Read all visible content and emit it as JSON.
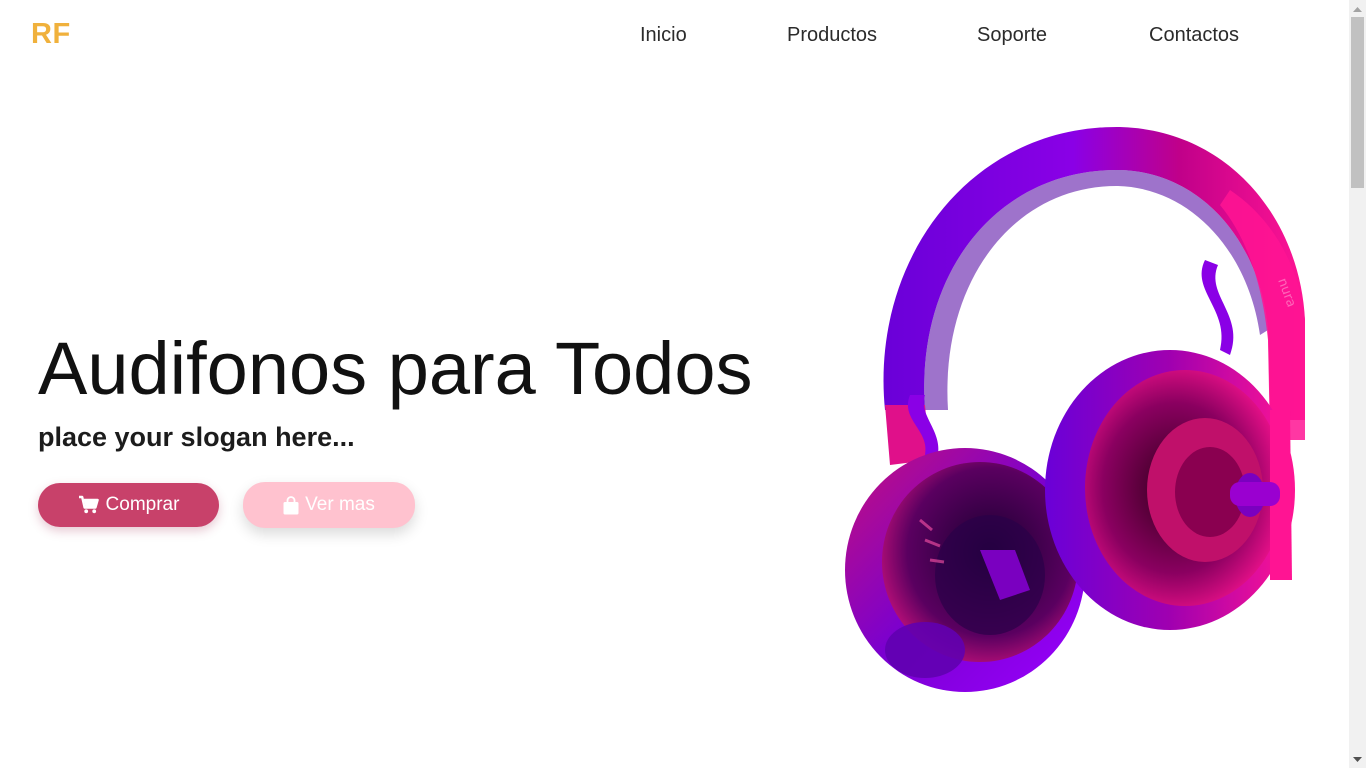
{
  "navbar": {
    "logo": "RF",
    "links": [
      "Inicio",
      "Productos",
      "Soporte",
      "Contactos"
    ]
  },
  "hero": {
    "title": "Audifonos para Todos",
    "slogan": "place your slogan here...",
    "buttons": {
      "buy": {
        "label": "Comprar",
        "icon": "shopping-cart-icon"
      },
      "more": {
        "label": "Ver mas",
        "icon": "shopping-bag-icon"
      }
    },
    "image": {
      "subject": "headphones",
      "brand_text": "nura"
    }
  },
  "colors": {
    "logo": "#f0b13c",
    "buy_button": "#c8416a",
    "more_button": "#ffc2cf",
    "headphones_primary": "#8a00e6",
    "headphones_secondary": "#ff1493"
  }
}
